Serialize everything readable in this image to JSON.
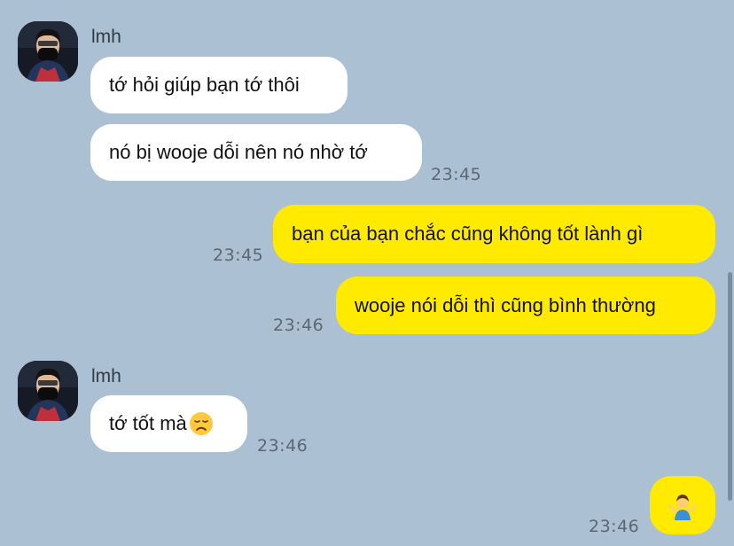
{
  "messages": [
    {
      "sender": "lmh",
      "text": "tớ hỏi giúp bạn tớ thôi"
    },
    {
      "text": "nó bị wooje dỗi nên nó nhờ tớ",
      "time": "23:45"
    },
    {
      "text": "bạn của bạn chắc cũng không tốt lành gì",
      "time": "23:45"
    },
    {
      "text": "wooje nói dỗi thì cũng bình thường",
      "time": "23:46"
    },
    {
      "sender": "lmh",
      "text": "tớ tốt mà",
      "emoji": "disappointed-face-icon",
      "time": "23:46"
    },
    {
      "emoji": "person-shrugging-icon",
      "time": "23:46"
    }
  ],
  "colors": {
    "background": "#abc0d2",
    "incoming_bubble": "#ffffff",
    "outgoing_bubble": "#ffea00"
  }
}
